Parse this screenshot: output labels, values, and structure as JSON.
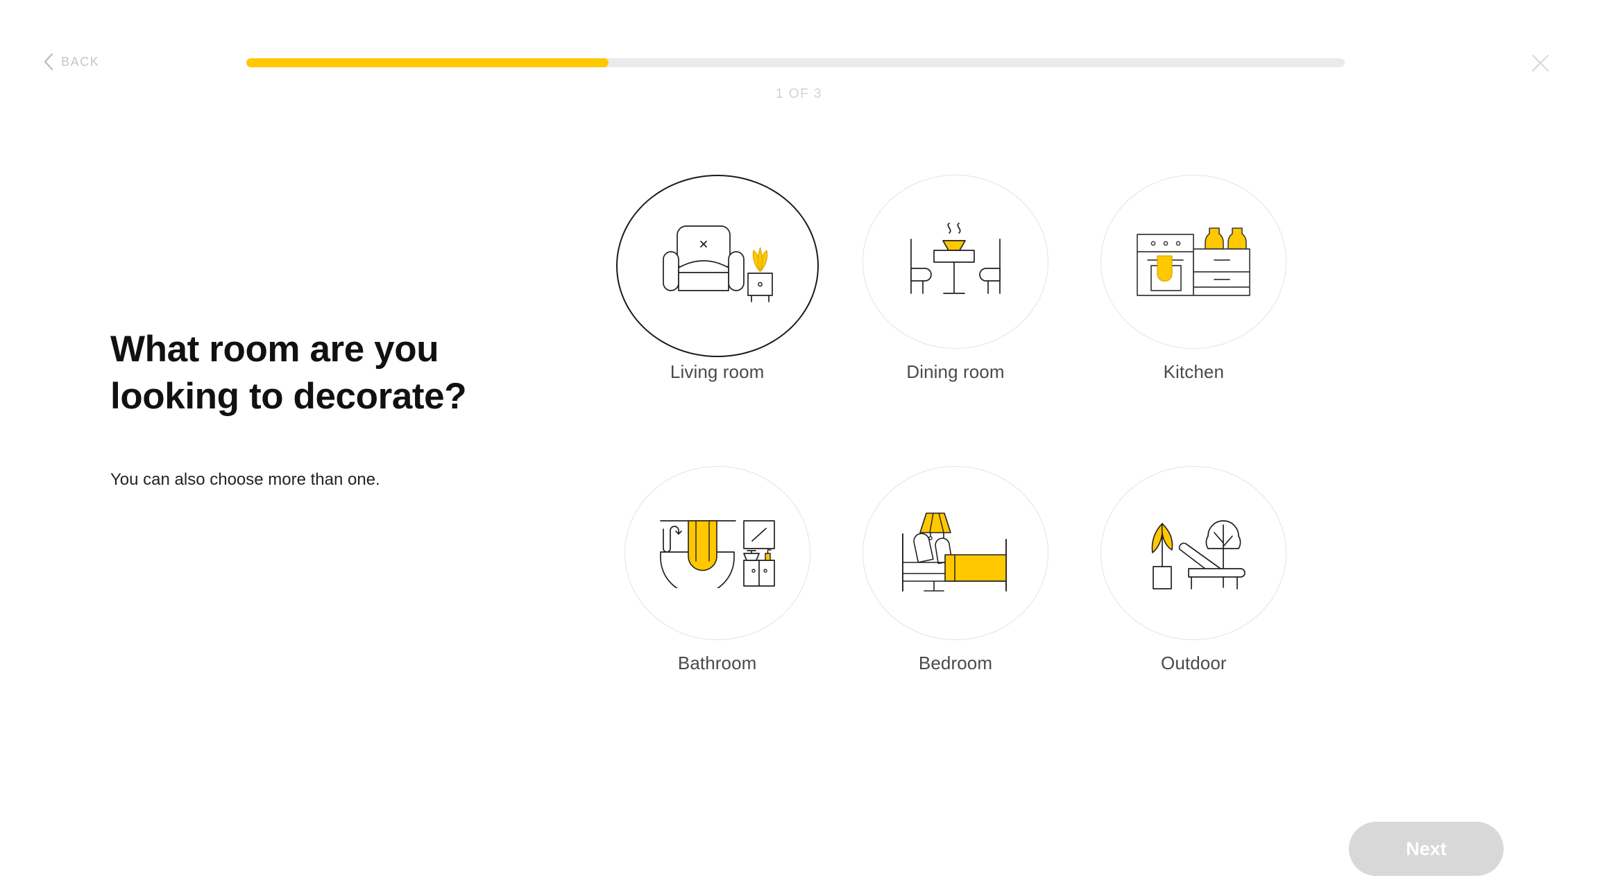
{
  "header": {
    "back_label": "BACK",
    "back_icon": "chevron-left-icon",
    "close_icon": "close-icon",
    "step_counter": "1 OF 3",
    "progress_percent": 33,
    "accent_color": "#ffc800",
    "track_color": "#ebebeb"
  },
  "copy": {
    "headline_line1": "What room are you",
    "headline_line2": "looking to decorate?",
    "subcopy": "You can also choose more than one."
  },
  "options": [
    {
      "id": "living-room",
      "label": "Living room",
      "icon": "armchair-plant-icon",
      "selected": true
    },
    {
      "id": "dining-room",
      "label": "Dining room",
      "icon": "dining-table-icon",
      "selected": false
    },
    {
      "id": "kitchen",
      "label": "Kitchen",
      "icon": "kitchen-oven-icon",
      "selected": false
    },
    {
      "id": "bathroom",
      "label": "Bathroom",
      "icon": "bathtub-vanity-icon",
      "selected": false
    },
    {
      "id": "bedroom",
      "label": "Bedroom",
      "icon": "bed-lamp-icon",
      "selected": false
    },
    {
      "id": "outdoor",
      "label": "Outdoor",
      "icon": "parasol-tree-lounger-icon",
      "selected": false
    }
  ],
  "footer": {
    "next_label": "Next",
    "next_enabled": false
  }
}
